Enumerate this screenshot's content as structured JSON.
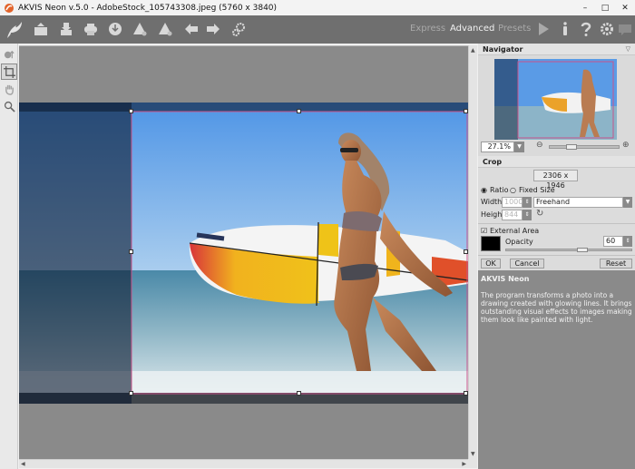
{
  "window": {
    "title": "AKVIS Neon v.5.0 - AdobeStock_105743308.jpeg (5760 x 3840)",
    "controls": {
      "minimize": "–",
      "maximize": "□",
      "close": "✕"
    }
  },
  "toolbar": {
    "buttons": [
      {
        "name": "logo-icon"
      },
      {
        "name": "open-image-icon"
      },
      {
        "name": "save-image-icon"
      },
      {
        "name": "print-icon"
      },
      {
        "name": "share-icon"
      },
      {
        "name": "import-preset-icon"
      },
      {
        "name": "export-preset-icon"
      },
      {
        "name": "undo-icon"
      },
      {
        "name": "redo-icon"
      },
      {
        "name": "batch-settings-icon"
      }
    ],
    "modes": [
      "Express",
      "Advanced",
      "Presets"
    ],
    "active_mode": "Advanced",
    "right_icons": [
      "run-icon",
      "info-icon",
      "help-icon",
      "preferences-icon",
      "notification-icon"
    ]
  },
  "left_tools": [
    "before-after-icon",
    "crop-icon",
    "hand-icon",
    "zoom-icon"
  ],
  "navigator": {
    "title": "Navigator",
    "zoom_value": "27.1%",
    "zoom_slider_fraction": 0.36
  },
  "crop": {
    "title": "Crop",
    "size_readout": "2306 x 1946",
    "mode_options": [
      "Ratio",
      "Fixed Size"
    ],
    "selected_mode": "Ratio",
    "width_label": "Width",
    "width_value": "1000",
    "height_label": "Height",
    "height_value": "844",
    "preset_value": "Freehand",
    "external_area_label": "External Area",
    "external_area_checked": true,
    "external_color": "#000000",
    "opacity_label": "Opacity",
    "opacity_value": "60",
    "ok_label": "OK",
    "cancel_label": "Cancel",
    "reset_label": "Reset"
  },
  "info": {
    "title": "AKVIS Neon",
    "text": "The program transforms a photo into a drawing created with glowing lines. It brings outstanding visual effects to images making them look like painted with light."
  },
  "colors": {
    "toolbar_bg": "#6f6f6f",
    "canvas_bg": "#8a8a8a",
    "panel_bg": "#dcdcdc",
    "crop_frame": "#c9538a"
  }
}
